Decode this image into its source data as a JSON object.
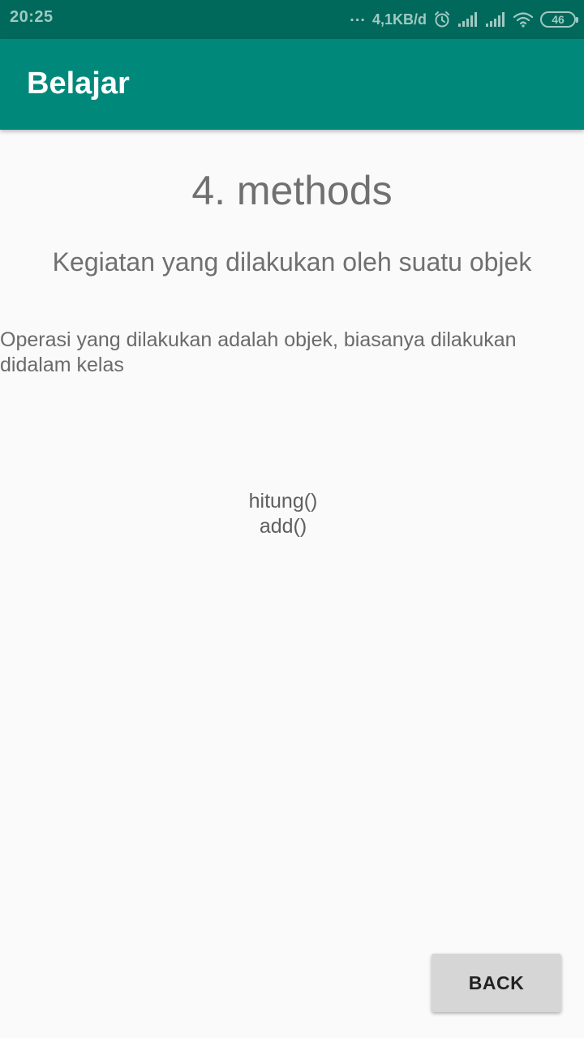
{
  "status_bar": {
    "time": "20:25",
    "dots": "...",
    "net_speed": "4,1KB/d",
    "battery_level": "46",
    "icons": [
      "alarm-icon",
      "signal-icon",
      "signal-icon",
      "wifi-icon",
      "battery-icon"
    ]
  },
  "app_bar": {
    "title": "Belajar"
  },
  "content": {
    "heading": "4. methods",
    "subheading": "Kegiatan yang dilakukan oleh suatu objek",
    "description": "Operasi yang dilakukan adalah objek, biasanya dilakukan didalam kelas",
    "examples": [
      "hitung()",
      "add()"
    ]
  },
  "actions": {
    "back_label": "BACK"
  },
  "colors": {
    "status_bar": "#00695c",
    "app_bar": "#00897b",
    "background": "#fafafa",
    "button": "#d6d6d6"
  }
}
